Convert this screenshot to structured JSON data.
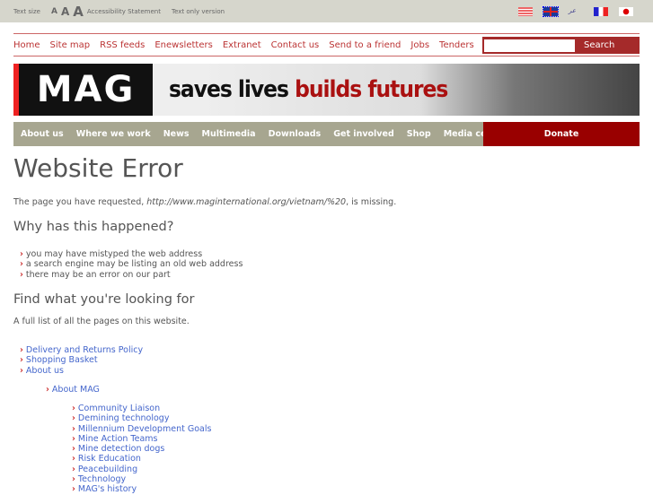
{
  "topbar": {
    "text_size": "Text size",
    "a_small": "A",
    "a_med": "A",
    "a_large": "A",
    "accessibility": "Accessibility Statement",
    "text_only": "Text only version",
    "flags": [
      "us-flag",
      "uk-flag",
      "arabic-flag",
      "french-flag",
      "japanese-flag"
    ]
  },
  "toplinks": [
    "Home",
    "Site map",
    "RSS feeds",
    "Enewsletters",
    "Extranet",
    "Contact us",
    "Send to a friend",
    "Jobs",
    "Tenders"
  ],
  "search": {
    "button": "Search",
    "value": ""
  },
  "banner": {
    "logo": "MAG",
    "tag1": "saves lives",
    "tag2": "builds futures"
  },
  "mainnav": [
    "About us",
    "Where we work",
    "News",
    "Multimedia",
    "Downloads",
    "Get involved",
    "Shop",
    "Media centre"
  ],
  "donate": "Donate",
  "content": {
    "title": "Website Error",
    "intro_pre": "The page you have requested, ",
    "url": "http://www.maginternational.org/vietnam/%20",
    "intro_post": ", is missing.",
    "why_heading": "Why has this happened?",
    "reasons": [
      "you may have mistyped the web address",
      "a search engine may be listing an old web address",
      "there may be an error on our part"
    ],
    "find_heading": "Find what you're looking for",
    "find_text": "A full list of all the pages on this website.",
    "links_l1": [
      "Delivery and Returns Policy",
      "Shopping Basket",
      "About us"
    ],
    "links_l2": [
      "About MAG"
    ],
    "links_l3": [
      "Community Liaison",
      "Demining technology",
      "Millennium Development Goals",
      "Mine Action Teams",
      "Mine detection dogs",
      "Risk Education",
      "Peacebuilding",
      "Technology",
      "MAG's history"
    ]
  },
  "colors": {
    "accent": "#b33333",
    "donate": "#990000",
    "nav": "#a7a690",
    "link": "#4466cc"
  }
}
